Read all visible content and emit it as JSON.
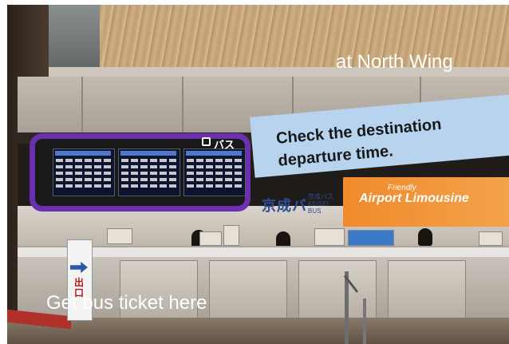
{
  "captions": {
    "top_right": "at North Wing",
    "bottom_left": "Get bus ticket here"
  },
  "callout": {
    "text": "Check the destination\ndeparture  time."
  },
  "photo_signs": {
    "board_header": "バス",
    "keisei_logo": "京成バ",
    "keisei_sub": "京成バス KEISEI BUS",
    "airport_limousine": "Airport Limousine",
    "friendly": "Friendly",
    "exit_sign": "出口"
  },
  "colors": {
    "highlight_border": "#6c2fb0",
    "callout_fill": "#b8d3ed",
    "caption_text": "#ffffff",
    "limousine_orange": "#f08a2c",
    "keisei_blue": "#2d4f96"
  }
}
